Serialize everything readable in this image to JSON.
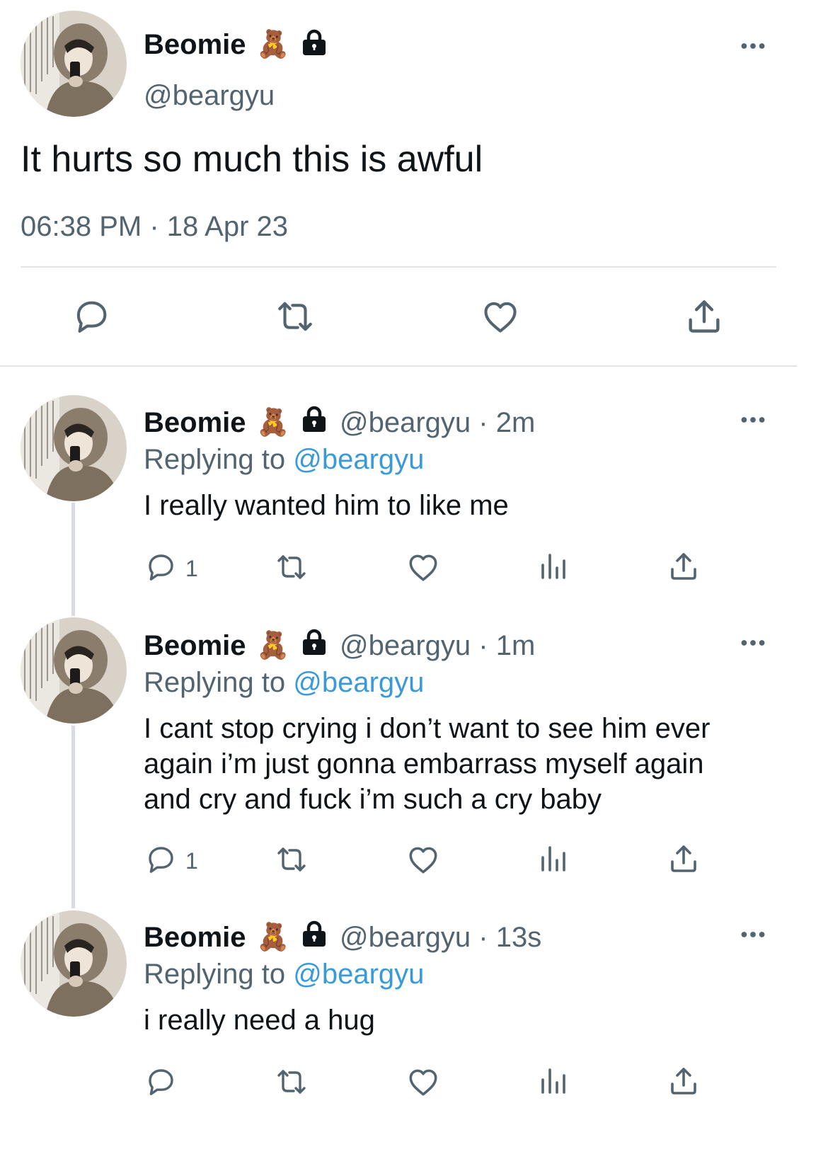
{
  "main_tweet": {
    "name": "Beomie",
    "handle": "@beargyu",
    "text": "It hurts so much this is awful",
    "timestamp": "06:38 PM · 18 Apr 23"
  },
  "replies": [
    {
      "name": "Beomie",
      "handle_time": "@beargyu · 2m",
      "replying_label": "Replying to",
      "replying_to": "@beargyu",
      "text": "I really wanted him to like me",
      "reply_count": "1"
    },
    {
      "name": "Beomie",
      "handle_time": "@beargyu · 1m",
      "replying_label": "Replying to",
      "replying_to": "@beargyu",
      "text_lines": [
        "I cant stop crying i don’t want to see him ever",
        "again i’m just gonna embarrass myself again",
        "and cry and fuck i’m such a cry baby"
      ],
      "reply_count": "1"
    },
    {
      "name": "Beomie",
      "handle_time": "@beargyu · 13s",
      "replying_label": "Replying to",
      "replying_to": "@beargyu",
      "text": "i really need a hug",
      "reply_count": ""
    }
  ],
  "emoji": "🧸",
  "icons": [
    "teddy-bear-icon",
    "lock-icon",
    "more-icon",
    "reply-icon",
    "retweet-icon",
    "like-icon",
    "views-icon",
    "share-icon"
  ],
  "colors": {
    "text": "#0f1419",
    "secondary": "#536471",
    "mention": "#3a9ad9",
    "divider": "#e1e4e8"
  }
}
